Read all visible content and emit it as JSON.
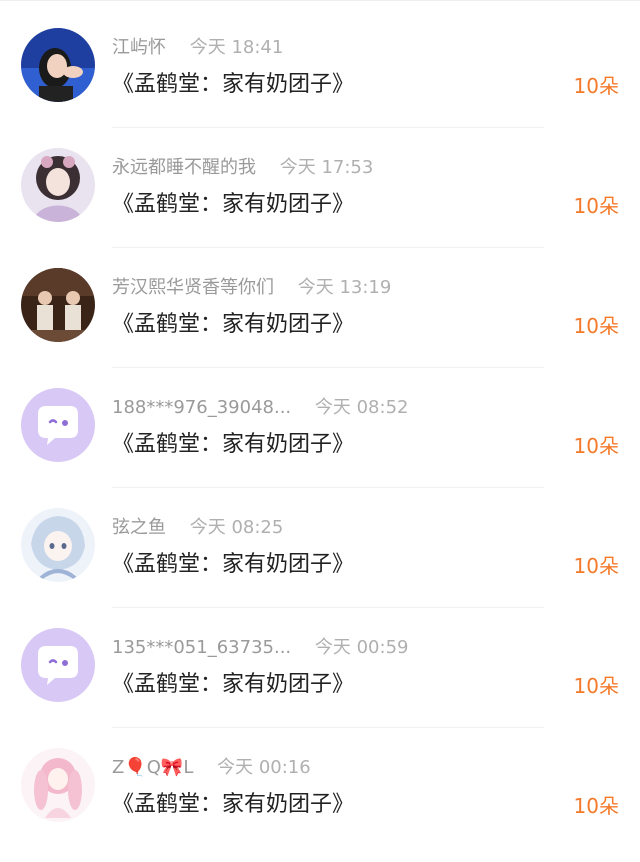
{
  "rows": [
    {
      "username": "江屿怀",
      "time": "今天 18:41",
      "gift": "《孟鹤堂：家有奶团子》",
      "count": "10朵",
      "avatar": "portrait-photo"
    },
    {
      "username": "永远都睡不醒的我",
      "time": "今天 17:53",
      "gift": "《孟鹤堂：家有奶团子》",
      "count": "10朵",
      "avatar": "illustrated-girl"
    },
    {
      "username": "芳汉熙华贤香等你们",
      "time": "今天 13:19",
      "gift": "《孟鹤堂：家有奶团子》",
      "count": "10朵",
      "avatar": "stage-photo"
    },
    {
      "username": "188***976_39048...",
      "time": "今天 08:52",
      "gift": "《孟鹤堂：家有奶团子》",
      "count": "10朵",
      "avatar": "default-chat-bubble"
    },
    {
      "username": "弦之鱼",
      "time": "今天 08:25",
      "gift": "《孟鹤堂：家有奶团子》",
      "count": "10朵",
      "avatar": "anime-girl"
    },
    {
      "username": "135***051_63735...",
      "time": "今天 00:59",
      "gift": "《孟鹤堂：家有奶团子》",
      "count": "10朵",
      "avatar": "default-chat-bubble"
    },
    {
      "username": "Z🎈Q🎀L",
      "time": "今天 00:16",
      "gift": "《孟鹤堂：家有奶团子》",
      "count": "10朵",
      "avatar": "pink-anime-girl"
    }
  ],
  "colors": {
    "accent": "#f47a2a",
    "username": "#9a9a9a",
    "text": "#222222",
    "default_avatar_bg": "#d8c8f6"
  }
}
